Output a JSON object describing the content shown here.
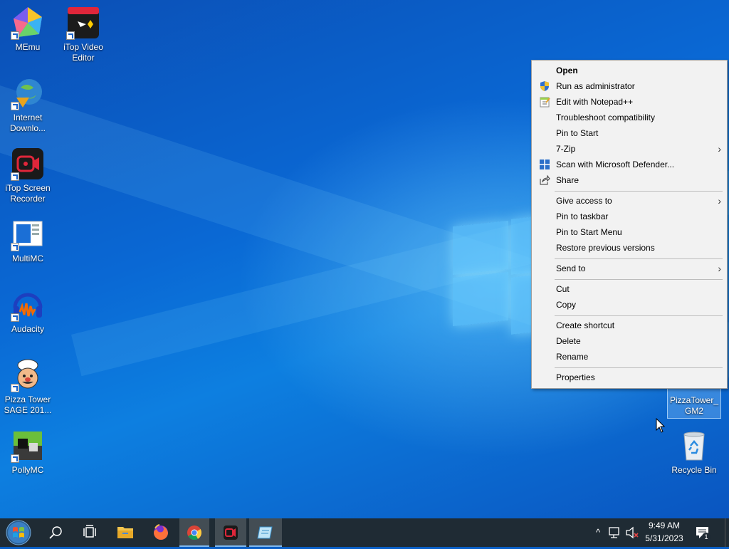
{
  "desktop": {
    "icons": [
      {
        "label": "MEmu"
      },
      {
        "label": "iTop Video Editor"
      },
      {
        "label": "Internet Downlo..."
      },
      {
        "label": "iTop Screen Recorder"
      },
      {
        "label": "MultiMC"
      },
      {
        "label": "Audacity"
      },
      {
        "label": "Pizza Tower SAGE 201..."
      },
      {
        "label": "PollyMC"
      },
      {
        "label": "PizzaTower_GM2"
      },
      {
        "label": "Recycle Bin"
      }
    ]
  },
  "context_menu": {
    "items": [
      {
        "label": "Open"
      },
      {
        "label": "Run as administrator",
        "icon": "shield-icon"
      },
      {
        "label": "Edit with Notepad++",
        "icon": "notepad-plus-plus-icon"
      },
      {
        "label": "Troubleshoot compatibility"
      },
      {
        "label": "Pin to Start"
      },
      {
        "label": "7-Zip",
        "submenu": true
      },
      {
        "label": "Scan with Microsoft Defender...",
        "icon": "defender-icon"
      },
      {
        "label": "Share",
        "icon": "share-icon"
      },
      {
        "label": "Give access to",
        "submenu": true
      },
      {
        "label": "Pin to taskbar"
      },
      {
        "label": "Pin to Start Menu"
      },
      {
        "label": "Restore previous versions"
      },
      {
        "label": "Send to",
        "submenu": true
      },
      {
        "label": "Cut"
      },
      {
        "label": "Copy"
      },
      {
        "label": "Create shortcut"
      },
      {
        "label": "Delete"
      },
      {
        "label": "Rename"
      },
      {
        "label": "Properties"
      }
    ],
    "submenu_arrow": "›"
  },
  "taskbar": {
    "clock_time": "9:49 AM",
    "clock_date": "5/31/2023",
    "notification_count": "1",
    "tray_chevron": "^"
  },
  "colors": {
    "taskbar": "#1f2b34",
    "menu_bg": "#f2f2f2",
    "accent": "#0a68d4"
  }
}
